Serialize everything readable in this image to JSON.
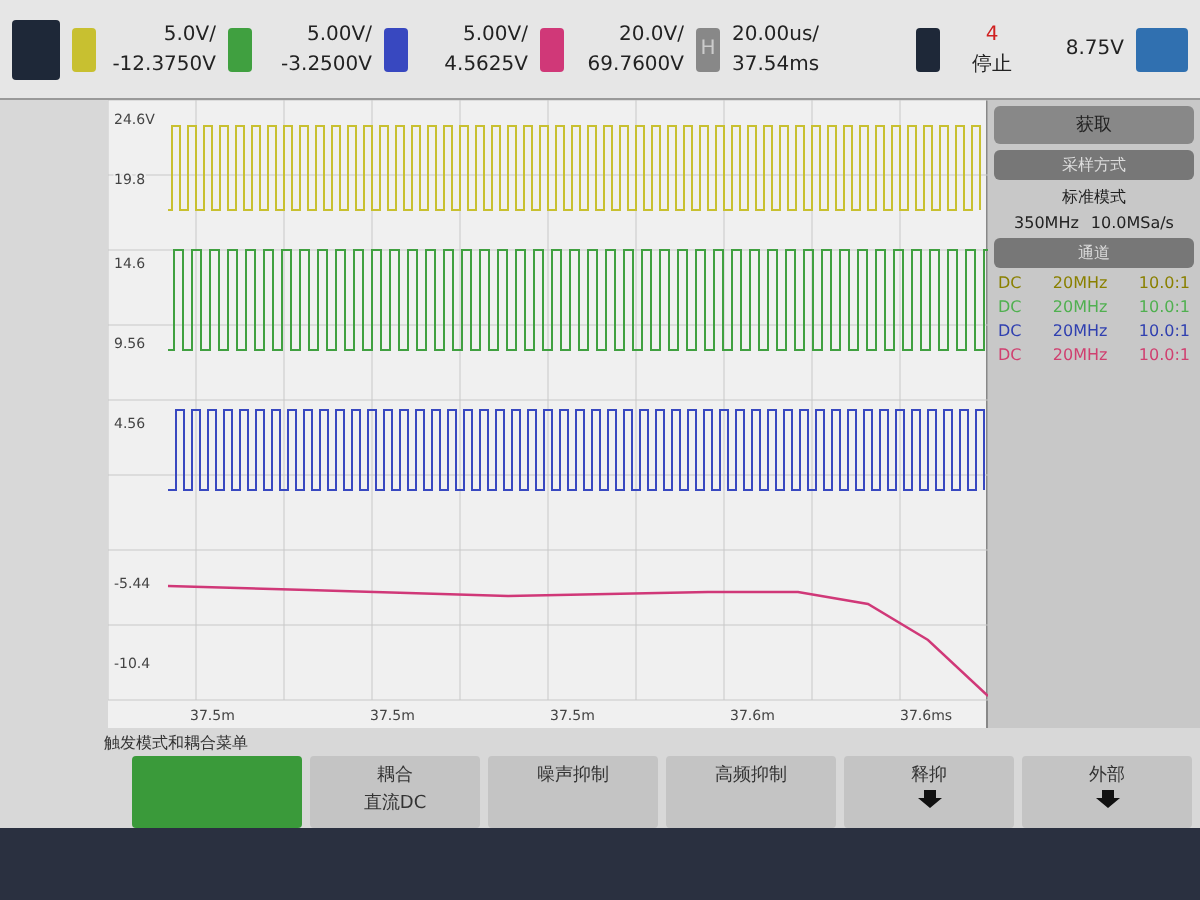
{
  "channels": [
    {
      "scale": "5.0V/",
      "offset": "-12.3750V",
      "color": "#c8c030"
    },
    {
      "scale": "5.00V/",
      "offset": "-3.2500V",
      "color": "#40a040"
    },
    {
      "scale": "5.00V/",
      "offset": "4.5625V",
      "color": "#3848c0"
    },
    {
      "scale": "20.0V/",
      "offset": "69.7600V",
      "color": "#d03878"
    }
  ],
  "timebase": {
    "label": "H",
    "scale": "20.00us/",
    "position": "37.54ms"
  },
  "trigger": {
    "source": "4",
    "level": "8.75V",
    "status": "停止"
  },
  "plot": {
    "y_labels": [
      "24.6V",
      "19.8",
      "14.6",
      "9.56",
      "4.56",
      "-5.44",
      "-10.4"
    ],
    "x_labels": [
      "37.5m",
      "37.5m",
      "37.5m",
      "37.6m",
      "37.6ms"
    ]
  },
  "panel": {
    "title": "获取",
    "sections": [
      {
        "header": "采样方式",
        "lines": [
          "标准模式"
        ],
        "rates": [
          "350MHz",
          "10.0MSa/s"
        ]
      },
      {
        "header": "通道"
      }
    ],
    "channel_rows": [
      {
        "coupling": "DC",
        "bandwidth": "20MHz",
        "probe": "10.0:1",
        "color": "#8a8000"
      },
      {
        "coupling": "DC",
        "bandwidth": "20MHz",
        "probe": "10.0:1",
        "color": "#50b050"
      },
      {
        "coupling": "DC",
        "bandwidth": "20MHz",
        "probe": "10.0:1",
        "color": "#3040b0"
      },
      {
        "coupling": "DC",
        "bandwidth": "20MHz",
        "probe": "10.0:1",
        "color": "#d04070"
      }
    ]
  },
  "menu": {
    "title": "触发模式和耦合菜单",
    "buttons": [
      {
        "selected": true,
        "arrow": false
      },
      {
        "lines": [
          "耦合",
          "直流DC"
        ],
        "selected": false,
        "arrow": false
      },
      {
        "lines": [
          "噪声抑制"
        ],
        "selected": false,
        "arrow": false
      },
      {
        "lines": [
          "高频抑制"
        ],
        "selected": false,
        "arrow": false
      },
      {
        "lines": [
          "释抑"
        ],
        "selected": false,
        "arrow": true
      },
      {
        "lines": [
          "外部"
        ],
        "selected": false,
        "arrow": true
      }
    ]
  }
}
